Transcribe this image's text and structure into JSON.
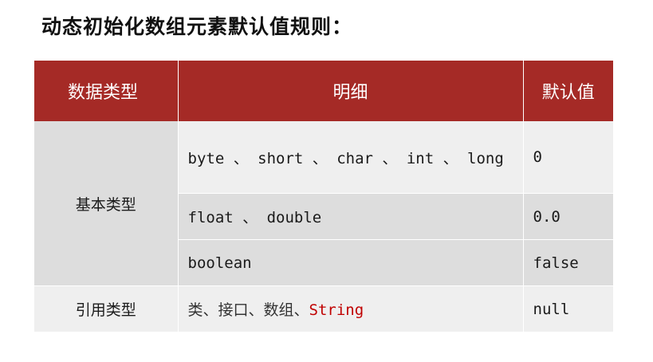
{
  "title": "动态初始化数组元素默认值规则：",
  "headers": {
    "type": "数据类型",
    "detail": "明细",
    "default": "默认值"
  },
  "rows": [
    {
      "detail": "byte 、 short 、 char 、 int 、 long",
      "default": "0"
    },
    {
      "detail": "float 、 double",
      "default": "0.0"
    },
    {
      "detail": "boolean",
      "default": "false"
    }
  ],
  "basic_category": "基本类型",
  "reference": {
    "category": "引用类型",
    "detail_prefix": "类、接口、数组、",
    "detail_string": "String",
    "default": "null"
  },
  "colors": {
    "header_bg": "#a52a26",
    "row_light": "#efefef",
    "row_dark": "#dddddd",
    "string_highlight": "#c00000"
  }
}
